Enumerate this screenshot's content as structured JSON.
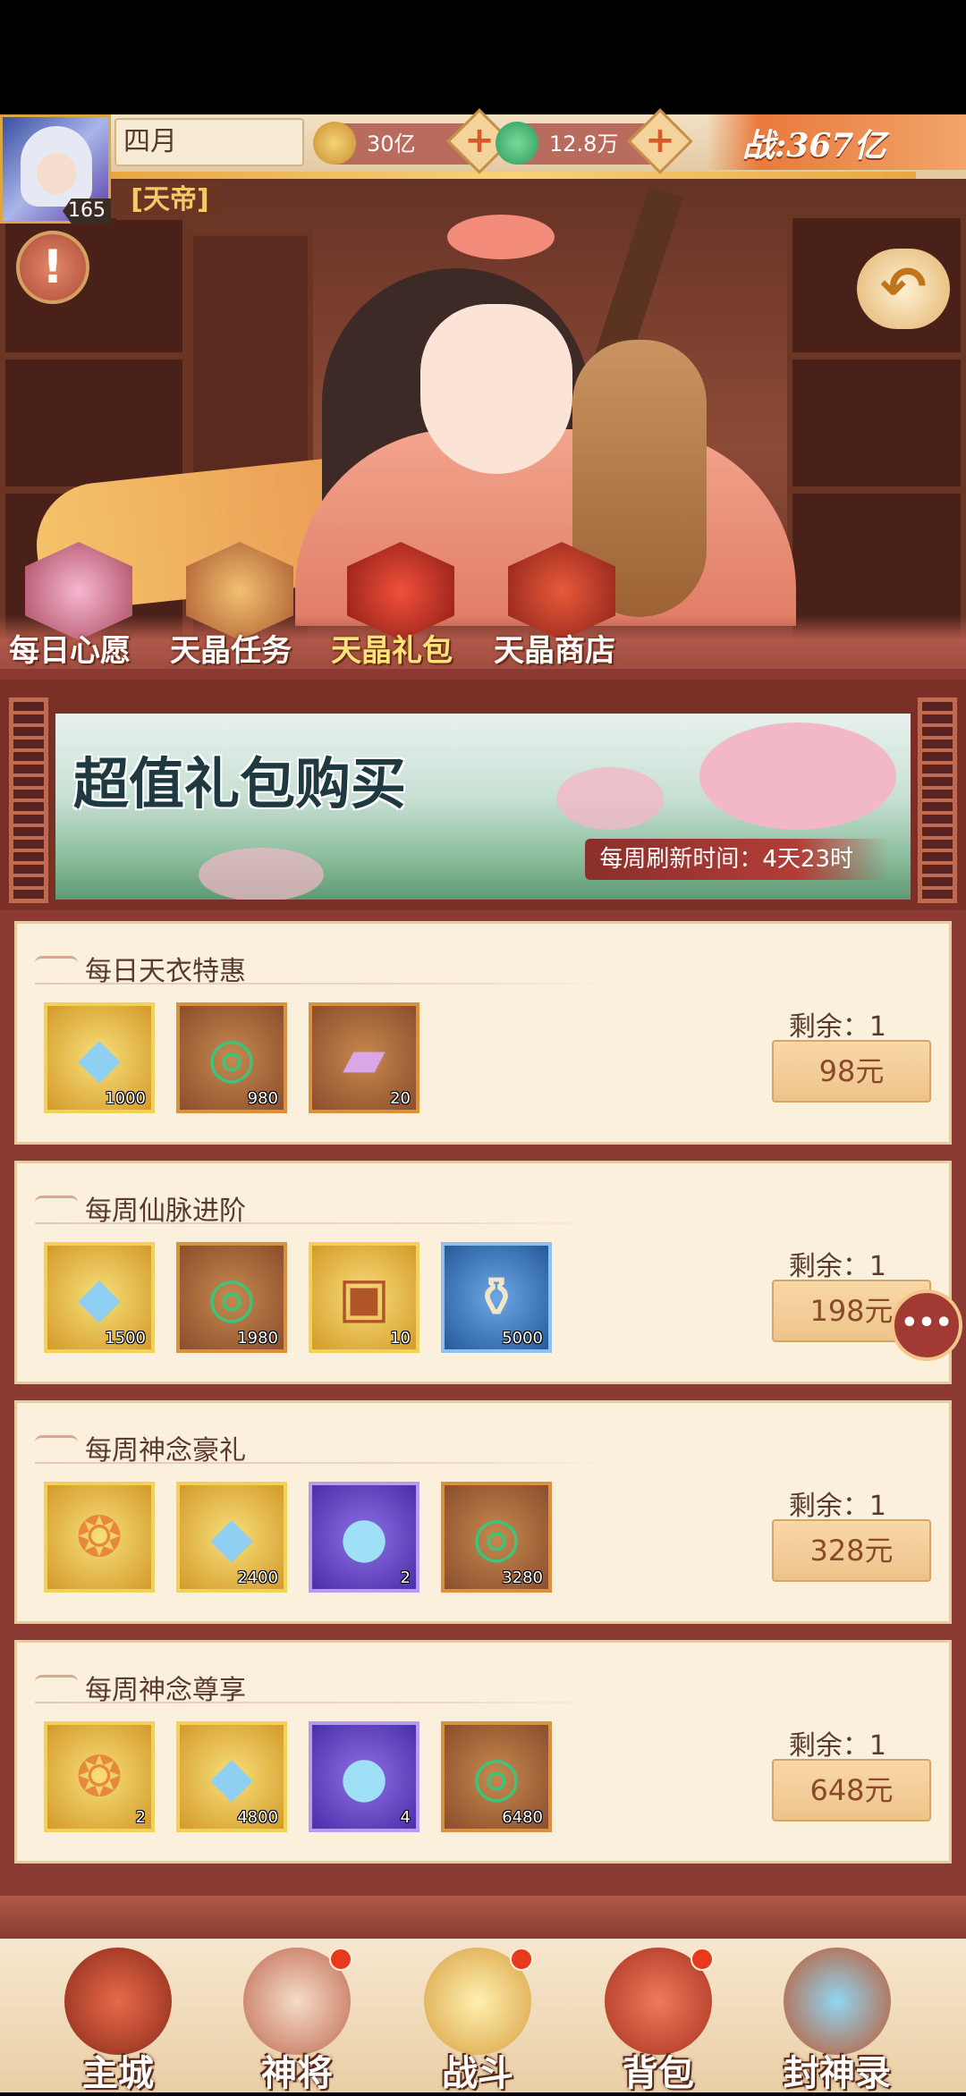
{
  "player": {
    "name": "四月",
    "level": "165",
    "title": "[天帝]",
    "power": "战:367亿"
  },
  "resources": {
    "coins": "30亿",
    "jade": "12.8万"
  },
  "icons": {
    "alert": "!",
    "back": "↶",
    "plus": "+",
    "chat": "•••"
  },
  "features": [
    {
      "label": "每日心愿"
    },
    {
      "label": "天晶任务"
    },
    {
      "label": "天晶礼包"
    },
    {
      "label": "天晶商店"
    }
  ],
  "banner": {
    "title": "超值礼包购买",
    "refresh": "每周刷新时间：4天23时"
  },
  "packages": [
    {
      "title": "每日天衣特惠",
      "remaining": "剩余：1",
      "price": "98元",
      "items": [
        {
          "icon": "crystal-crest-icon",
          "count": "1000"
        },
        {
          "icon": "jade-ring-icon",
          "count": "980"
        },
        {
          "icon": "silk-scroll-icon",
          "count": "20"
        }
      ]
    },
    {
      "title": "每周仙脉进阶",
      "remaining": "剩余：1",
      "price": "198元",
      "items": [
        {
          "icon": "crystal-crest-icon",
          "count": "1500"
        },
        {
          "icon": "jade-ring-icon",
          "count": "1980"
        },
        {
          "icon": "treasure-chest-icon",
          "count": "10"
        },
        {
          "icon": "potion-bottle-icon",
          "count": "5000"
        }
      ]
    },
    {
      "title": "每周神念豪礼",
      "remaining": "剩余：1",
      "price": "328元",
      "items": [
        {
          "icon": "spirit-flame-icon",
          "count": ""
        },
        {
          "icon": "crystal-crest-icon",
          "count": "2400"
        },
        {
          "icon": "spirit-orb-icon",
          "count": "2"
        },
        {
          "icon": "jade-ring-icon",
          "count": "3280"
        }
      ]
    },
    {
      "title": "每周神念尊享",
      "remaining": "剩余：1",
      "price": "648元",
      "items": [
        {
          "icon": "spirit-flame-icon",
          "count": "2"
        },
        {
          "icon": "crystal-crest-icon",
          "count": "4800"
        },
        {
          "icon": "spirit-orb-icon",
          "count": "4"
        },
        {
          "icon": "jade-ring-icon",
          "count": "6480"
        }
      ]
    }
  ],
  "nav": [
    {
      "label": "主城",
      "badge": false
    },
    {
      "label": "神将",
      "badge": true
    },
    {
      "label": "战斗",
      "badge": true
    },
    {
      "label": "背包",
      "badge": true
    },
    {
      "label": "封神录",
      "badge": false
    }
  ],
  "colors": {
    "panel": "#8a3a32",
    "card": "#faf0dc",
    "price_button": "#eec38a",
    "badge_dot": "#e8381e"
  }
}
